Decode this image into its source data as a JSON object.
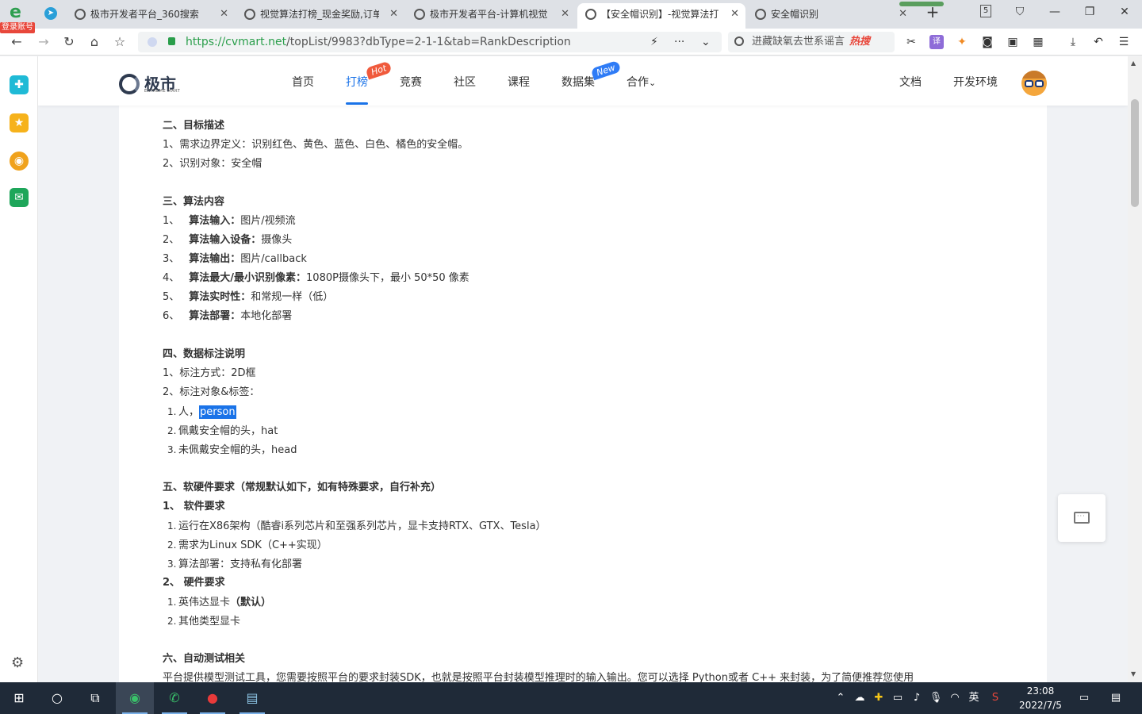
{
  "browser": {
    "login_badge": "登录账号",
    "tabs": [
      {
        "title": "极市开发者平台_360搜索"
      },
      {
        "title": "视觉算法打榜_现金奖励,订单"
      },
      {
        "title": "极市开发者平台-计算机视觉"
      },
      {
        "title": "【安全帽识别】-视觉算法打"
      },
      {
        "title": "安全帽识别"
      }
    ],
    "tab_count": "5",
    "url_host": "https://cvmart.net",
    "url_path": "/topList/9983?dbType=2-1-1&tab=RankDescription",
    "search_text": "进藏缺氧去世系谣言",
    "search_hot": "热搜"
  },
  "site": {
    "logo": "极市",
    "logo_sub": "EXTREME MART",
    "nav": [
      {
        "label": "首页"
      },
      {
        "label": "打榜",
        "badge": "Hot"
      },
      {
        "label": "竞赛"
      },
      {
        "label": "社区"
      },
      {
        "label": "课程"
      },
      {
        "label": "数据集",
        "badge": "New"
      },
      {
        "label": "合作"
      }
    ],
    "right_nav": [
      {
        "label": "文档"
      },
      {
        "label": "开发环境"
      }
    ]
  },
  "article": {
    "s2_title": "二、目标描述",
    "s2_l1": "1、需求边界定义：识别红色、黄色、蓝色、白色、橘色的安全帽。",
    "s2_l2": "2、识别对象：安全帽",
    "s3_title": "三、算法内容",
    "s3_items": [
      {
        "num": "1、",
        "label": "算法输入：",
        "value": "图片/视频流"
      },
      {
        "num": "2、",
        "label": "算法输入设备：",
        "value": "摄像头"
      },
      {
        "num": "3、",
        "label": "算法输出：",
        "value": "图片/callback"
      },
      {
        "num": "4、",
        "label": "算法最大/最小识别像素：",
        "value": "1080P摄像头下，最小 50*50 像素"
      },
      {
        "num": "5、",
        "label": "算法实时性：",
        "value": "和常规一样（低）"
      },
      {
        "num": "6、",
        "label": "算法部署：",
        "value": "本地化部署"
      }
    ],
    "s4_title": "四、数据标注说明",
    "s4_l1": "1、标注方式：2D框",
    "s4_l2": "2、标注对象&标签：",
    "s4_sub1_num": "1.",
    "s4_sub1_text": "人，",
    "s4_sub1_sel": "person",
    "s4_sub2_num": "2.",
    "s4_sub2_text": "佩戴安全帽的头，hat",
    "s4_sub3_num": "3.",
    "s4_sub3_text": "未佩戴安全帽的头，head",
    "s5_title": "五、软硬件要求（常规默认如下，如有特殊要求，自行补充）",
    "s5_soft": "1、 软件要求",
    "s5_soft_items": [
      {
        "num": "1.",
        "text": "运行在X86架构（酷睿i系列芯片和至强系列芯片，显卡支持RTX、GTX、Tesla）"
      },
      {
        "num": "2.",
        "text": "需求为Linux SDK（C++实现）"
      },
      {
        "num": "3.",
        "text": "算法部署：支持私有化部署"
      }
    ],
    "s5_hard": "2、 硬件要求",
    "s5_hard_items": [
      {
        "num": "1.",
        "text": "英伟达显卡",
        "bold": "（默认）"
      },
      {
        "num": "2.",
        "text": "其他类型显卡"
      }
    ],
    "s6_title": "六、自动测试相关",
    "s6_l1": "平台提供模型测试工具，您需要按照平台的要求封装SDK，也就是按照平台封装模型推理时的输入输出。您可以选择 Python或者 C++ 来封装，为了简便推荐您使用"
  },
  "taskbar": {
    "time": "23:08",
    "date": "2022/7/5",
    "ime": "英"
  },
  "colors": {
    "accent": "#1a73e8",
    "hot_badge": "#f05a3c",
    "new_badge": "#2f7cf6",
    "url_green": "#2a9e4b"
  }
}
